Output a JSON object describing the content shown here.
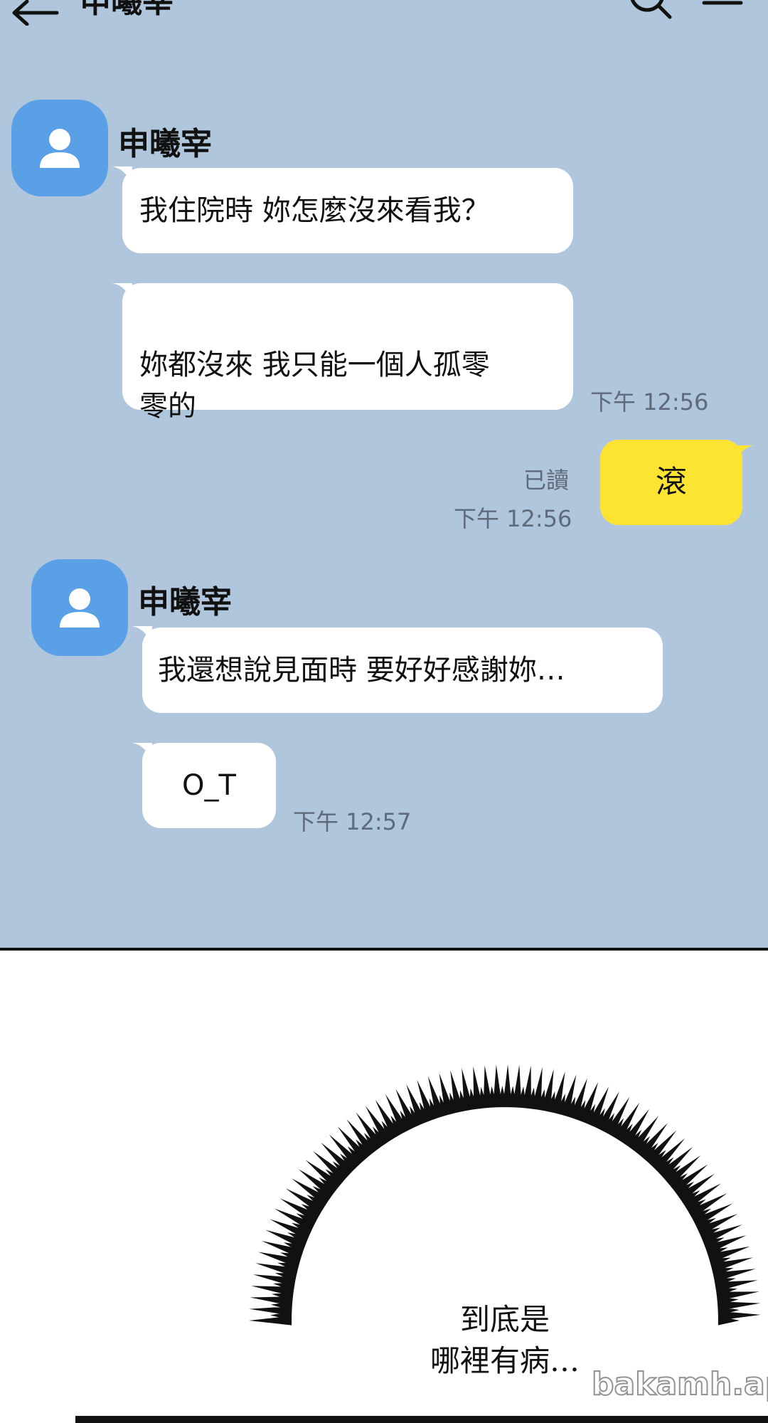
{
  "header": {
    "title": "申曦宰"
  },
  "messages": [
    {
      "sender": "申曦宰",
      "bubbles": [
        "我住院時 妳怎麼沒來看我？",
        "妳都沒來 我只能一個人孤零\n零的"
      ],
      "time": "下午 12:56"
    },
    {
      "mine": true,
      "text": "滾",
      "read": "已讀",
      "time": "下午 12:56"
    },
    {
      "sender": "申曦宰",
      "bubbles": [
        "我還想說見面時 要好好感謝妳…",
        "O_T"
      ],
      "time": "下午 12:57"
    }
  ],
  "panel": {
    "thought_line1": "到底是",
    "thought_line2": "哪裡有病…",
    "watermark": "bakamh.app"
  },
  "colors": {
    "chat_bg": "#b0c6dc",
    "avatar": "#5aa0e6",
    "my_bubble": "#fde432",
    "other_bubble": "#ffffff"
  }
}
